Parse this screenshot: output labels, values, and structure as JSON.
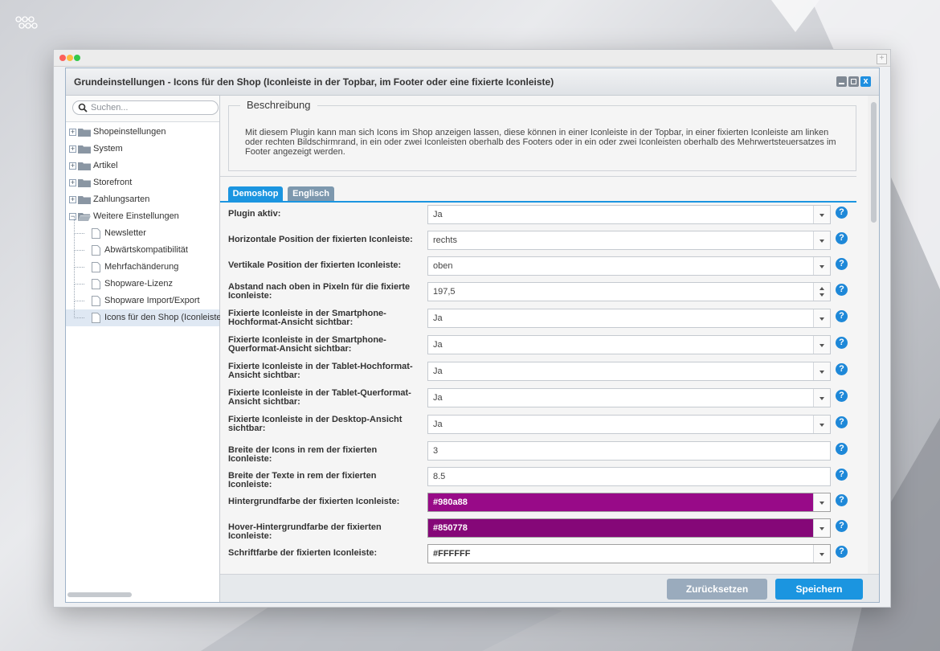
{
  "window": {
    "title": "Grundeinstellungen - Icons für den Shop (Iconleiste in der Topbar, im Footer oder eine fixierte Iconleiste)",
    "mac_plus": "+"
  },
  "search": {
    "placeholder": "Suchen..."
  },
  "tree": {
    "items": [
      {
        "label": "Shopeinstellungen",
        "expander": "+"
      },
      {
        "label": "System",
        "expander": "+"
      },
      {
        "label": "Artikel",
        "expander": "+"
      },
      {
        "label": "Storefront",
        "expander": "+"
      },
      {
        "label": "Zahlungsarten",
        "expander": "+"
      },
      {
        "label": "Weitere Einstellungen",
        "expander": "−"
      }
    ],
    "children": [
      {
        "label": "Newsletter"
      },
      {
        "label": "Abwärtskompatibilität"
      },
      {
        "label": "Mehrfachänderung"
      },
      {
        "label": "Shopware-Lizenz"
      },
      {
        "label": "Shopware Import/Export"
      },
      {
        "label": "Icons für den Shop (Iconleiste"
      }
    ]
  },
  "description": {
    "legend": "Beschreibung",
    "text": "Mit diesem Plugin kann man sich Icons im Shop anzeigen lassen, diese können in einer Iconleiste in der Topbar, in einer fixierten Iconleiste am linken oder rechten Bildschirmrand, in ein oder zwei Iconleisten oberhalb des Footers oder in ein oder zwei Iconleisten oberhalb des Mehrwertsteuersatzes im Footer angezeigt werden."
  },
  "tabs": [
    {
      "label": "Demoshop"
    },
    {
      "label": "Englisch"
    }
  ],
  "help_glyph": "?",
  "close_glyph": "x",
  "fields": [
    {
      "label": "Plugin aktiv:",
      "value": "Ja"
    },
    {
      "label": "Horizontale Position der fixierten Iconleiste:",
      "value": "rechts"
    },
    {
      "label": "Vertikale Position der fixierten Iconleiste:",
      "value": "oben"
    },
    {
      "label": "Abstand nach oben in Pixeln für die fixierte Iconleiste:",
      "value": "197,5"
    },
    {
      "label": "Fixierte Iconleiste in der Smartphone-Hochformat-Ansicht sichtbar:",
      "value": "Ja"
    },
    {
      "label": "Fixierte Iconleiste in der Smartphone-Querformat-Ansicht sichtbar:",
      "value": "Ja"
    },
    {
      "label": "Fixierte Iconleiste in der Tablet-Hochformat-Ansicht sichtbar:",
      "value": "Ja"
    },
    {
      "label": "Fixierte Iconleiste in der Tablet-Querformat-Ansicht sichtbar:",
      "value": "Ja"
    },
    {
      "label": "Fixierte Iconleiste in der Desktop-Ansicht sichtbar:",
      "value": "Ja"
    },
    {
      "label": "Breite der Icons in rem der fixierten Iconleiste:",
      "value": "3"
    },
    {
      "label": "Breite der Texte in rem der fixierten Iconleiste:",
      "value": "8.5"
    },
    {
      "label": "Hintergrundfarbe der fixierten Iconleiste:",
      "value": "#980a88",
      "color": "#980a88"
    },
    {
      "label": "Hover-Hintergrundfarbe der fixierten Iconleiste:",
      "value": "#850778",
      "color": "#850778"
    },
    {
      "label": "Schriftfarbe der fixierten Iconleiste:",
      "value": "#FFFFFF",
      "color": "#FFFFFF"
    }
  ],
  "buttons": {
    "reset": "Zurücksetzen",
    "save": "Speichern"
  },
  "colors": {
    "accent": "#1b95e0",
    "help": "#1e88d8",
    "reset_button": "#9aabbd"
  }
}
